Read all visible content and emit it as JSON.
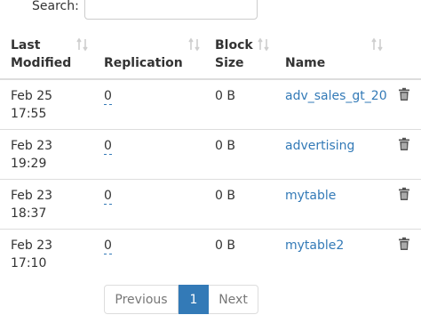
{
  "search": {
    "label": "Search:",
    "value": "",
    "placeholder": ""
  },
  "columns": {
    "last_modified": [
      "Last",
      "Modified"
    ],
    "replication": "Replication",
    "block_size": [
      "Block",
      "Size"
    ],
    "name": "Name"
  },
  "rows": [
    {
      "date": "Feb 25",
      "time": "17:55",
      "replication": "0",
      "block_size": "0 B",
      "name": "adv_sales_gt_20"
    },
    {
      "date": "Feb 23",
      "time": "19:29",
      "replication": "0",
      "block_size": "0 B",
      "name": "advertising"
    },
    {
      "date": "Feb 23",
      "time": "18:37",
      "replication": "0",
      "block_size": "0 B",
      "name": "mytable"
    },
    {
      "date": "Feb 23",
      "time": "17:10",
      "replication": "0",
      "block_size": "0 B",
      "name": "mytable2"
    }
  ],
  "pagination": {
    "previous": "Previous",
    "current": "1",
    "next": "Next"
  },
  "colors": {
    "link": "#337ab7",
    "active_page": "#337ab7",
    "border": "#dddddd"
  },
  "icons": {
    "sort": "sort-both-icon",
    "delete": "trash-icon"
  }
}
